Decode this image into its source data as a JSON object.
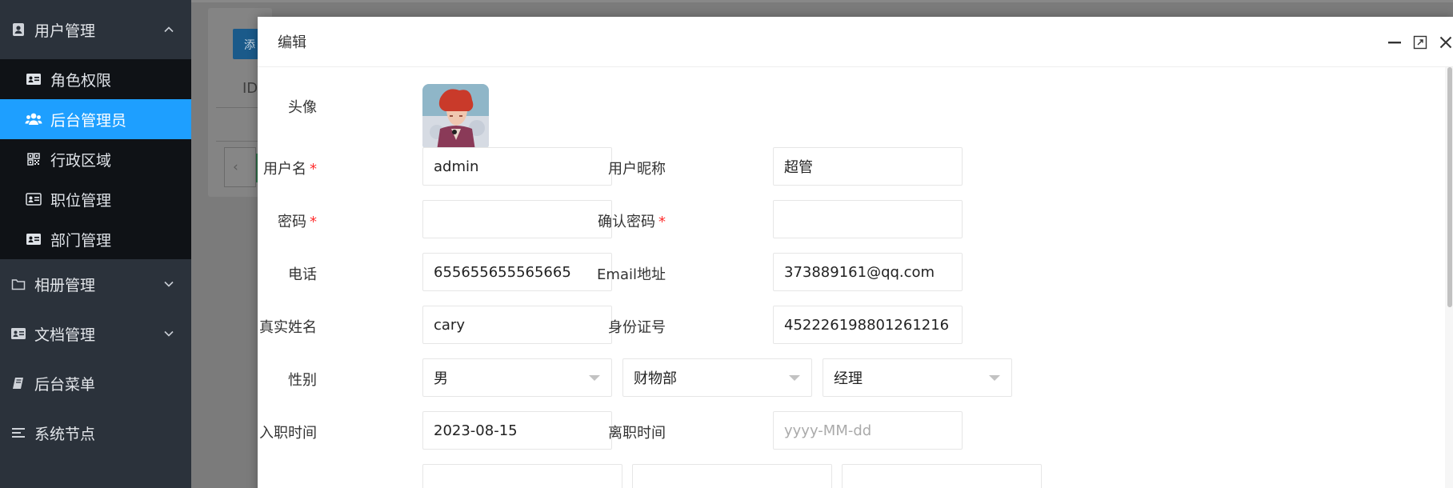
{
  "sidebar": {
    "group_user": {
      "label": "用户管理",
      "icon": "user-card-icon"
    },
    "items": [
      {
        "label": "角色权限",
        "icon": "id-card-icon"
      },
      {
        "label": "后台管理员",
        "icon": "users-icon"
      },
      {
        "label": "行政区域",
        "icon": "qrcode-icon"
      },
      {
        "label": "职位管理",
        "icon": "id-card-icon"
      },
      {
        "label": "部门管理",
        "icon": "id-card-icon"
      }
    ],
    "groups": [
      {
        "label": "相册管理",
        "icon": "folder-icon"
      },
      {
        "label": "文档管理",
        "icon": "id-card-icon"
      },
      {
        "label": "后台菜单",
        "icon": "book-icon"
      },
      {
        "label": "系统节点",
        "icon": "list-icon"
      }
    ],
    "accent": "#1e9fff"
  },
  "background": {
    "button": "添",
    "column": "ID",
    "pager_prev": "‹"
  },
  "dialog": {
    "title": "编辑",
    "fields": {
      "avatar_label": "头像",
      "username_label": "用户名",
      "username_value": "admin",
      "nickname_label": "用户昵称",
      "nickname_value": "超管",
      "password_label": "密码",
      "confirm_label": "确认密码",
      "phone_label": "电话",
      "phone_value": "655655655565665",
      "email_label": "Email地址",
      "email_value": "373889161@qq.com",
      "realname_label": "真实姓名",
      "realname_value": "cary",
      "idcard_label": "身份证号",
      "idcard_value": "452226198801261216",
      "gender_label": "性别",
      "gender_value": "男",
      "dept_value": "财物部",
      "position_value": "经理",
      "hire_label": "入职时间",
      "hire_value": "2023-08-15",
      "leave_label": "离职时间",
      "leave_placeholder": "yyyy-MM-dd"
    }
  }
}
